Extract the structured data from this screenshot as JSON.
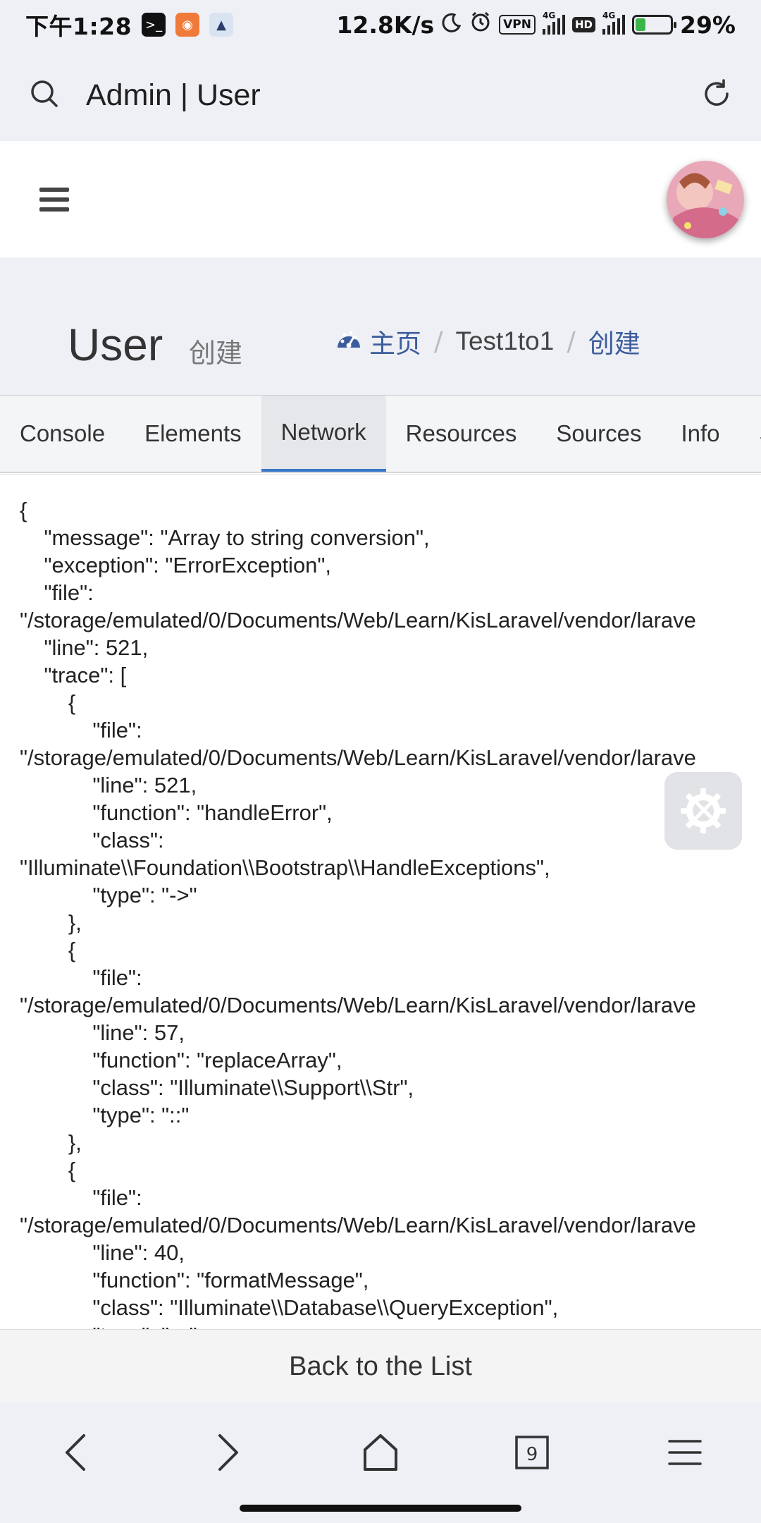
{
  "status_bar": {
    "time": "下午1:28",
    "network_speed": "12.8K/s",
    "vpn": "VPN",
    "hd": "HD",
    "sig1_label": "4G",
    "sig2_label": "4G",
    "battery": "29%",
    "battery_level": 0.29
  },
  "browser": {
    "page_title": "Admin | User"
  },
  "header": {
    "avatar_alt": "avatar"
  },
  "content_header": {
    "title": "User",
    "subtitle": "创建",
    "breadcrumb": {
      "home": "主页",
      "middle": "Test1to1",
      "active": "创建"
    }
  },
  "tabs": [
    "Console",
    "Elements",
    "Network",
    "Resources",
    "Sources",
    "Info",
    "S"
  ],
  "active_tab": "Network",
  "output_lines": [
    "{",
    "    \"message\": \"Array to string conversion\",",
    "    \"exception\": \"ErrorException\",",
    "    \"file\":",
    "\"/storage/emulated/0/Documents/Web/Learn/KisLaravel/vendor/larave",
    "    \"line\": 521,",
    "    \"trace\": [",
    "        {",
    "            \"file\":",
    "\"/storage/emulated/0/Documents/Web/Learn/KisLaravel/vendor/larave",
    "            \"line\": 521,",
    "            \"function\": \"handleError\",",
    "            \"class\":",
    "\"Illuminate\\\\Foundation\\\\Bootstrap\\\\HandleExceptions\",",
    "            \"type\": \"->\"",
    "        },",
    "        {",
    "            \"file\":",
    "\"/storage/emulated/0/Documents/Web/Learn/KisLaravel/vendor/larave",
    "            \"line\": 57,",
    "            \"function\": \"replaceArray\",",
    "            \"class\": \"Illuminate\\\\Support\\\\Str\",",
    "            \"type\": \"::\"",
    "        },",
    "        {",
    "            \"file\":",
    "\"/storage/emulated/0/Documents/Web/Learn/KisLaravel/vendor/larave",
    "            \"line\": 40,",
    "            \"function\": \"formatMessage\",",
    "            \"class\": \"Illuminate\\\\Database\\\\QueryException\",",
    "            \"type\": \"->\""
  ],
  "back_link": "Back to the List",
  "nav": {
    "tab_count": "9"
  },
  "colors": {
    "accent": "#3c5c9c",
    "tab_underline": "#3a78c9",
    "battery_fill": "#3bb54a"
  }
}
